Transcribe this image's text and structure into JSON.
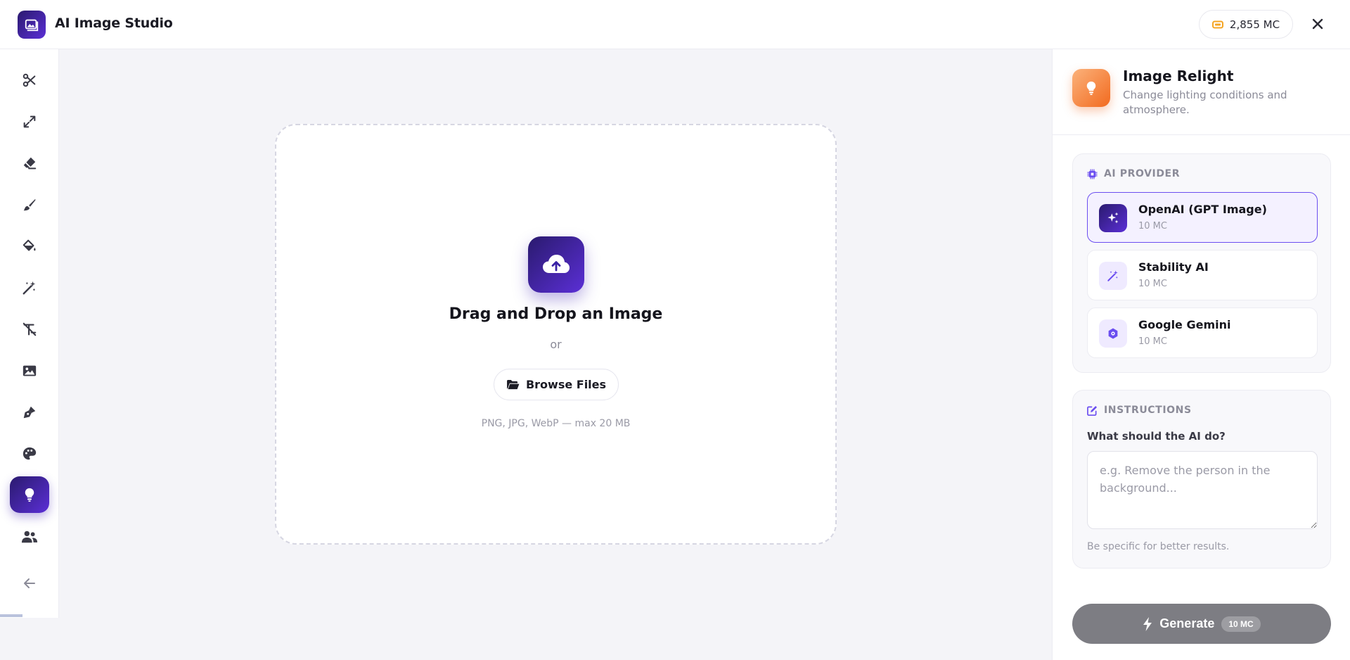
{
  "header": {
    "app_title": "AI Image Studio",
    "credits": "2,855 MC",
    "logo_icon": "image-icon",
    "close_icon": "close-icon"
  },
  "sidebar": {
    "tools": [
      {
        "icon": "scissors-icon",
        "active": false
      },
      {
        "icon": "expand-arrows-icon",
        "active": false
      },
      {
        "icon": "eraser-icon",
        "active": false
      },
      {
        "icon": "paintbrush-icon",
        "active": false
      },
      {
        "icon": "paint-bucket-icon",
        "active": false
      },
      {
        "icon": "magic-wand-icon",
        "active": false
      },
      {
        "icon": "remove-text-icon",
        "active": false
      },
      {
        "icon": "image-icon",
        "active": false
      },
      {
        "icon": "pen-nib-icon",
        "active": false
      },
      {
        "icon": "palette-icon",
        "active": false
      },
      {
        "icon": "lightbulb-icon",
        "active": true
      },
      {
        "icon": "users-icon",
        "active": false
      }
    ],
    "back_icon": "arrow-left-icon"
  },
  "dropzone": {
    "title": "Drag and Drop an Image",
    "or_text": "or",
    "browse_label": "Browse Files",
    "hint": "PNG, JPG, WebP — max 20 MB",
    "upload_icon": "cloud-upload-icon",
    "browse_icon": "folder-open-icon"
  },
  "panel": {
    "tool_name": "Image Relight",
    "tool_description": "Change lighting conditions and atmosphere.",
    "tool_icon": "lightbulb-icon",
    "provider_section_label": "AI PROVIDER",
    "provider_section_icon": "chip-icon",
    "providers": [
      {
        "name": "OpenAI (GPT Image)",
        "cost": "10 MC",
        "icon": "sparkles-icon",
        "selected": true
      },
      {
        "name": "Stability AI",
        "cost": "10 MC",
        "icon": "magic-wand-icon",
        "selected": false
      },
      {
        "name": "Google Gemini",
        "cost": "10 MC",
        "icon": "gem-cog-icon",
        "selected": false
      }
    ],
    "instructions_section_label": "INSTRUCTIONS",
    "instructions_section_icon": "edit-icon",
    "instructions_question": "What should the AI do?",
    "instructions_value": "",
    "instructions_placeholder": "e.g. Remove the person in the background...",
    "instructions_hint": "Be specific for better results.",
    "generate_label": "Generate",
    "generate_cost": "10 MC",
    "generate_icon": "bolt-icon"
  },
  "colors": {
    "brand_gradient_start": "#2a1a6e",
    "brand_gradient_end": "#5b2fd6",
    "relight_accent": "#f26a1f",
    "credit_coin": "#f5a524",
    "selected_border": "#6b4ef0",
    "generate_disabled": "#7d7d83"
  }
}
